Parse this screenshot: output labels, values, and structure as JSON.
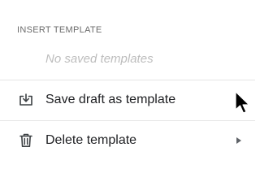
{
  "menu": {
    "section_header": "INSERT TEMPLATE",
    "empty_state": "No saved templates",
    "items": [
      {
        "label": "Save draft as template",
        "icon": "save-template-icon",
        "has_submenu": true
      },
      {
        "label": "Delete template",
        "icon": "trash-icon",
        "has_submenu": true
      }
    ]
  },
  "colors": {
    "text": "#202124",
    "muted": "#6b6b6b",
    "placeholder": "#bdbdbd",
    "divider": "#e6e6e6"
  }
}
